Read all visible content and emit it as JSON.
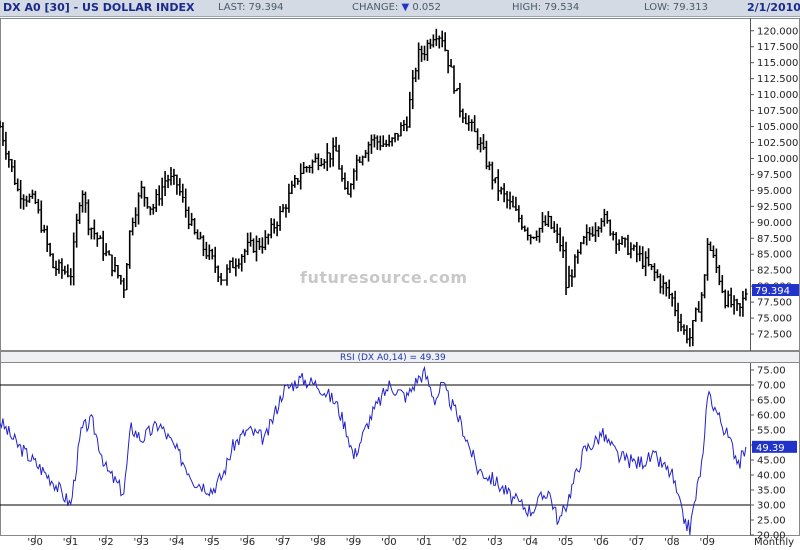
{
  "header": {
    "symbol": "DX A0 [30] - US DOLLAR INDEX",
    "last": "LAST: 79.394",
    "change_prefix": "CHANGE:",
    "change_arrow": "▼",
    "change_value": "0.052",
    "high": "HIGH: 79.534",
    "low": "LOW: 79.313",
    "date": "2/1/2010"
  },
  "watermark": "futuresource.com",
  "colors": {
    "price_bars": "#000000",
    "rsi_line": "#2222cc",
    "label_box": "#2233cc",
    "header_bg": "#d3dae3"
  },
  "chart_data": [
    {
      "type": "line",
      "style": "ohlc-bars",
      "frequency": "Monthly",
      "ylim": [
        70.0,
        122.0
      ],
      "y_ticks": [
        "72.500",
        "75.000",
        "77.500",
        "80.000",
        "82.500",
        "85.000",
        "87.500",
        "90.000",
        "92.500",
        "95.000",
        "97.500",
        "100.000",
        "102.500",
        "105.000",
        "107.500",
        "110.000",
        "112.500",
        "115.000",
        "117.500",
        "120.000"
      ],
      "last_label": "79.394",
      "x": [
        1989.0,
        1989.5,
        1990.0,
        1990.5,
        1991.0,
        1991.3,
        1991.5,
        1992.0,
        1992.5,
        1992.7,
        1993.0,
        1993.3,
        1993.7,
        1994.0,
        1994.5,
        1995.0,
        1995.3,
        1995.5,
        1996.0,
        1996.5,
        1997.0,
        1997.5,
        1998.0,
        1998.5,
        1998.8,
        1999.0,
        1999.5,
        2000.0,
        2000.5,
        2000.8,
        2001.0,
        2001.3,
        2001.5,
        2002.0,
        2002.5,
        2003.0,
        2003.5,
        2004.0,
        2004.5,
        2004.9,
        2005.0,
        2005.5,
        2005.9,
        2006.0,
        2006.5,
        2007.0,
        2007.5,
        2008.0,
        2008.3,
        2008.5,
        2008.9,
        2009.0,
        2009.3,
        2009.5,
        2009.9,
        2010.1
      ],
      "y": [
        105,
        95,
        93,
        83,
        82,
        96,
        90,
        85,
        80,
        90,
        95,
        92,
        97,
        96,
        88,
        84,
        81,
        83,
        86,
        87,
        92,
        98,
        100,
        101,
        93,
        99,
        103,
        102,
        106,
        116,
        117,
        120,
        119,
        108,
        103,
        96,
        92,
        88,
        90,
        86,
        80,
        87,
        90,
        91,
        87,
        85,
        82,
        78,
        73,
        72,
        80,
        87,
        82,
        78,
        76,
        79.394
      ]
    },
    {
      "type": "line",
      "title": "RSI (DX A0,14) = 49.39",
      "ylim": [
        20.0,
        77.0
      ],
      "y_ticks": [
        "20.00",
        "25.00",
        "30.00",
        "35.00",
        "40.00",
        "45.00",
        "50.00",
        "55.00",
        "60.00",
        "65.00",
        "70.00",
        "75.00"
      ],
      "reference_lines": [
        30,
        70
      ],
      "last_label": "49.39",
      "x": [
        1989.0,
        1989.5,
        1990.0,
        1990.5,
        1991.0,
        1991.3,
        1991.6,
        1992.0,
        1992.5,
        1992.7,
        1993.0,
        1993.5,
        1994.0,
        1994.5,
        1995.0,
        1995.3,
        1995.6,
        1996.0,
        1996.5,
        1997.0,
        1997.5,
        1998.0,
        1998.5,
        1998.8,
        1999.0,
        1999.5,
        2000.0,
        2000.5,
        2000.8,
        2001.0,
        2001.3,
        2001.5,
        2002.0,
        2002.5,
        2003.0,
        2003.5,
        2004.0,
        2004.5,
        2004.8,
        2005.0,
        2005.5,
        2005.9,
        2006.0,
        2006.5,
        2007.0,
        2007.5,
        2008.0,
        2008.3,
        2008.5,
        2008.9,
        2009.0,
        2009.3,
        2009.6,
        2009.9,
        2010.1
      ],
      "y": [
        58,
        50,
        44,
        38,
        30,
        55,
        58,
        42,
        34,
        56,
        52,
        57,
        48,
        38,
        35,
        40,
        50,
        55,
        52,
        68,
        72,
        70,
        64,
        55,
        46,
        60,
        70,
        66,
        72,
        74,
        65,
        70,
        58,
        42,
        38,
        32,
        28,
        35,
        24,
        30,
        48,
        52,
        54,
        46,
        44,
        46,
        40,
        26,
        22,
        48,
        68,
        60,
        52,
        44,
        49.39
      ]
    }
  ],
  "x_axis": {
    "labels": [
      "'90",
      "'91",
      "'92",
      "'93",
      "'94",
      "'95",
      "'96",
      "'97",
      "'98",
      "'99",
      "'00",
      "'01",
      "'02",
      "'03",
      "'04",
      "'05",
      "'06",
      "'07",
      "'08",
      "'09"
    ],
    "values": [
      1990,
      1991,
      1992,
      1993,
      1994,
      1995,
      1996,
      1997,
      1998,
      1999,
      2000,
      2001,
      2002,
      2003,
      2004,
      2005,
      2006,
      2007,
      2008,
      2009
    ],
    "frequency_label": "Monthly"
  }
}
